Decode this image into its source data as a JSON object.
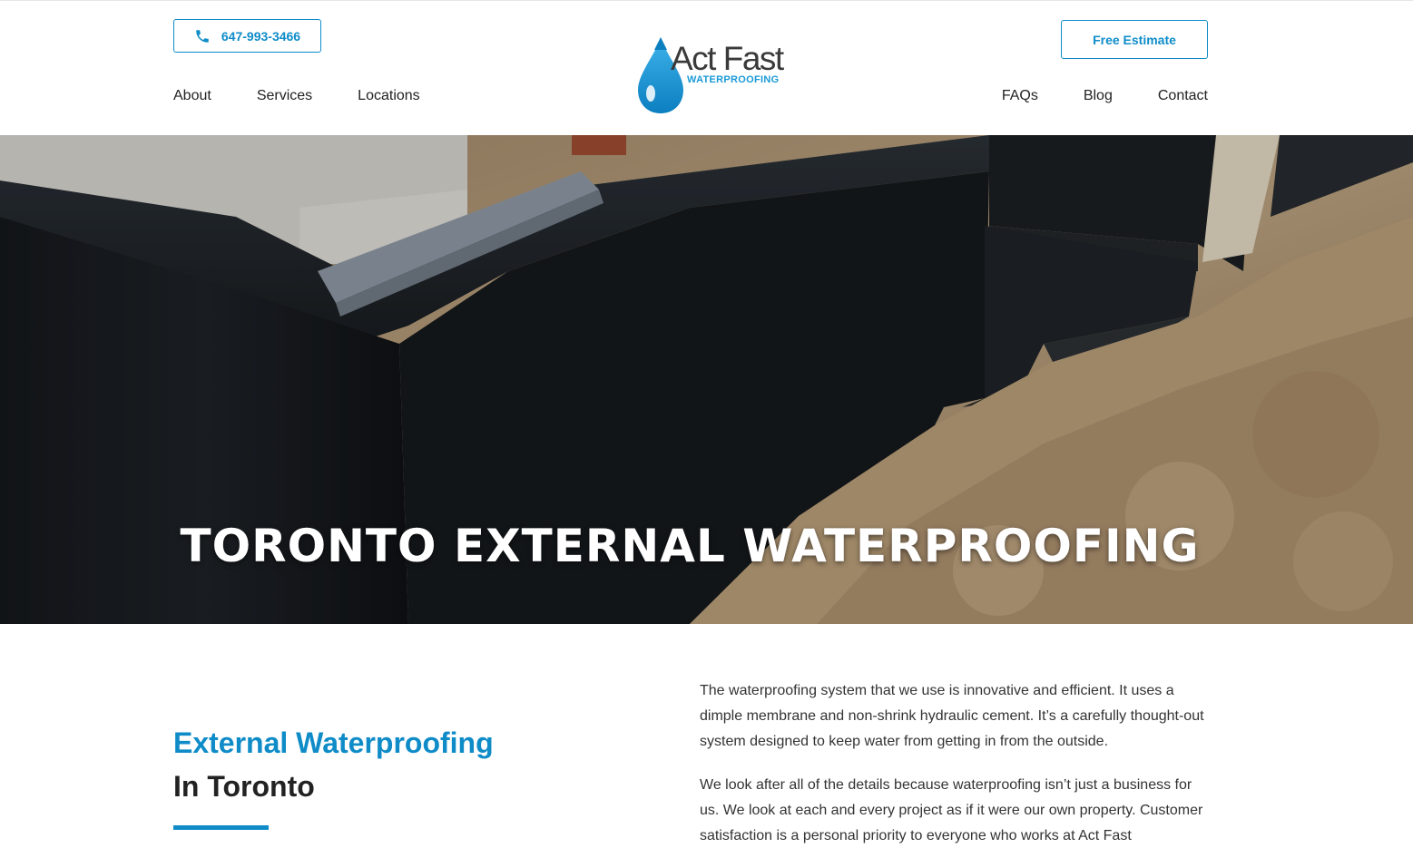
{
  "header": {
    "phone": "647-993-3466",
    "cta_label": "Free Estimate",
    "nav_left": [
      "About",
      "Services",
      "Locations"
    ],
    "nav_right": [
      "FAQs",
      "Blog",
      "Contact"
    ],
    "logo": {
      "name": "Act Fast",
      "tagline": "WATERPROOFING"
    }
  },
  "hero": {
    "title": "TORONTO EXTERNAL WATERPROOFING"
  },
  "intro": {
    "heading_accent": "External Waterproofing",
    "heading_main": "In Toronto",
    "paragraphs": [
      "The waterproofing system that we use is innovative and efficient. It uses a dimple membrane and non-shrink hydraulic cement. It’s a carefully thought-out system designed to keep water from getting in from the outside.",
      "We look after all of the details because waterproofing isn’t just a business for us. We look at each and every project as if it were our own property. Customer satisfaction is a personal priority to everyone who works at Act Fast"
    ]
  },
  "colors": {
    "accent": "#0f8cc8",
    "text_dark": "#222222",
    "text_body": "#333333"
  },
  "icons": {
    "phone": "phone-icon",
    "logo_drop": "water-drop-icon"
  }
}
